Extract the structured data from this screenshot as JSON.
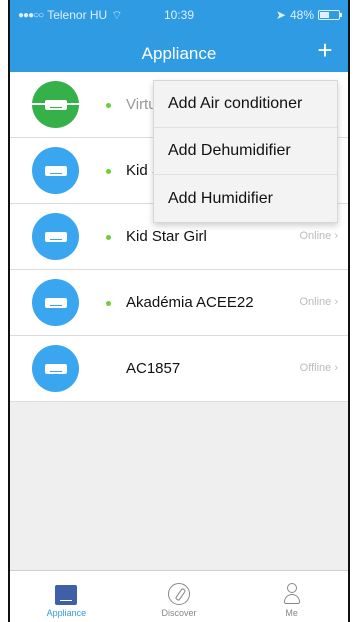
{
  "status_bar": {
    "carrier": "Telenor HU",
    "time": "10:39",
    "battery": "48%",
    "battery_level": 0.48
  },
  "header": {
    "title": "Appliance",
    "add_symbol": "+"
  },
  "menu": {
    "items": [
      "Add Air conditioner",
      "Add Dehumidifier",
      "Add Humidifier"
    ]
  },
  "devices": [
    {
      "name": "Virtu",
      "status": "",
      "icon": "green-ac-icon"
    },
    {
      "name": "Kid S",
      "status": "",
      "icon": "ac-icon"
    },
    {
      "name": "Kid Star Girl",
      "status": "Online",
      "icon": "ac-icon"
    },
    {
      "name": "Akadémia ACEE22",
      "status": "Online",
      "icon": "ac-icon"
    },
    {
      "name": "AC1857",
      "status": "Offline",
      "icon": "ac-icon"
    }
  ],
  "tabs": {
    "appliance": "Appliance",
    "discover": "Discover",
    "me": "Me"
  },
  "colors": {
    "header": "#2f9be3",
    "icon_blue": "#3aa6ef",
    "icon_green": "#36b14a",
    "online_dot": "#6dcc3a"
  }
}
